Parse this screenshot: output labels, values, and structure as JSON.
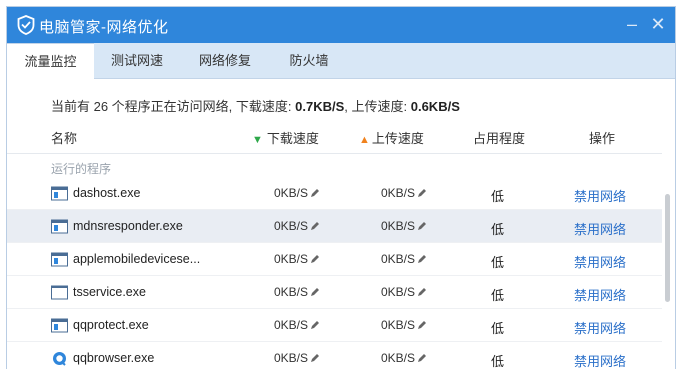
{
  "window": {
    "title": "电脑管家-网络优化"
  },
  "tabs": [
    {
      "label": "流量监控",
      "active": true
    },
    {
      "label": "测试网速",
      "active": false
    },
    {
      "label": "网络修复",
      "active": false
    },
    {
      "label": "防火墙",
      "active": false
    }
  ],
  "summary": {
    "prefix": "当前有 26 个程序正在访问网络, 下载速度: ",
    "download": "0.7KB/S",
    "middle": ", 上传速度: ",
    "upload": "0.6KB/S"
  },
  "columns": {
    "name": "名称",
    "download": "下载速度",
    "upload": "上传速度",
    "usage": "占用程度",
    "action": "操作"
  },
  "group": {
    "label": "运行的程序"
  },
  "rows": [
    {
      "name": "dashost.exe",
      "icon": "app-window-icon",
      "download": "0KB/S",
      "upload": "0KB/S",
      "usage": "低",
      "action": "禁用网络"
    },
    {
      "name": "mdnsresponder.exe",
      "icon": "app-window-icon",
      "download": "0KB/S",
      "upload": "0KB/S",
      "usage": "低",
      "action": "禁用网络"
    },
    {
      "name": "applemobiledevicese...",
      "icon": "app-window-icon",
      "download": "0KB/S",
      "upload": "0KB/S",
      "usage": "低",
      "action": "禁用网络"
    },
    {
      "name": "tsservice.exe",
      "icon": "blank-window-icon",
      "download": "0KB/S",
      "upload": "0KB/S",
      "usage": "低",
      "action": "禁用网络"
    },
    {
      "name": "qqprotect.exe",
      "icon": "app-window-icon",
      "download": "0KB/S",
      "upload": "0KB/S",
      "usage": "低",
      "action": "禁用网络"
    },
    {
      "name": "qqbrowser.exe",
      "icon": "qq-browser-icon",
      "download": "0KB/S",
      "upload": "0KB/S",
      "usage": "低",
      "action": "禁用网络"
    }
  ],
  "colors": {
    "title_bar": "#2f86db",
    "tab_bar": "#d8e7f6",
    "link": "#2a6fc9",
    "highlight_row": "#e9edf3"
  }
}
